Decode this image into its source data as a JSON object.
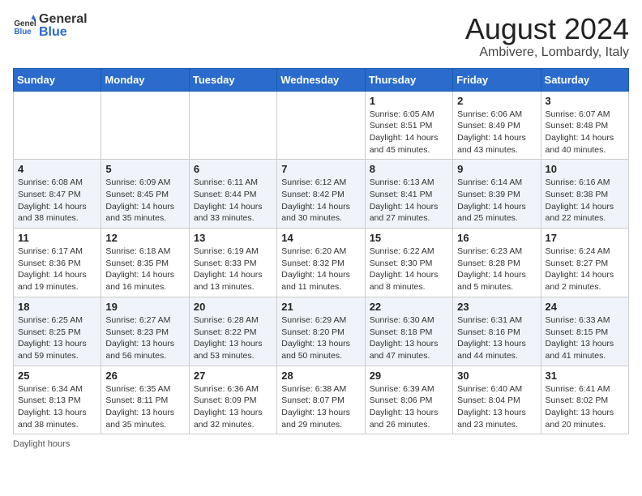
{
  "header": {
    "logo_general": "General",
    "logo_blue": "Blue",
    "main_title": "August 2024",
    "subtitle": "Ambivere, Lombardy, Italy"
  },
  "calendar": {
    "weekdays": [
      "Sunday",
      "Monday",
      "Tuesday",
      "Wednesday",
      "Thursday",
      "Friday",
      "Saturday"
    ],
    "weeks": [
      [
        {
          "day": "",
          "info": ""
        },
        {
          "day": "",
          "info": ""
        },
        {
          "day": "",
          "info": ""
        },
        {
          "day": "",
          "info": ""
        },
        {
          "day": "1",
          "info": "Sunrise: 6:05 AM\nSunset: 8:51 PM\nDaylight: 14 hours and 45 minutes."
        },
        {
          "day": "2",
          "info": "Sunrise: 6:06 AM\nSunset: 8:49 PM\nDaylight: 14 hours and 43 minutes."
        },
        {
          "day": "3",
          "info": "Sunrise: 6:07 AM\nSunset: 8:48 PM\nDaylight: 14 hours and 40 minutes."
        }
      ],
      [
        {
          "day": "4",
          "info": "Sunrise: 6:08 AM\nSunset: 8:47 PM\nDaylight: 14 hours and 38 minutes."
        },
        {
          "day": "5",
          "info": "Sunrise: 6:09 AM\nSunset: 8:45 PM\nDaylight: 14 hours and 35 minutes."
        },
        {
          "day": "6",
          "info": "Sunrise: 6:11 AM\nSunset: 8:44 PM\nDaylight: 14 hours and 33 minutes."
        },
        {
          "day": "7",
          "info": "Sunrise: 6:12 AM\nSunset: 8:42 PM\nDaylight: 14 hours and 30 minutes."
        },
        {
          "day": "8",
          "info": "Sunrise: 6:13 AM\nSunset: 8:41 PM\nDaylight: 14 hours and 27 minutes."
        },
        {
          "day": "9",
          "info": "Sunrise: 6:14 AM\nSunset: 8:39 PM\nDaylight: 14 hours and 25 minutes."
        },
        {
          "day": "10",
          "info": "Sunrise: 6:16 AM\nSunset: 8:38 PM\nDaylight: 14 hours and 22 minutes."
        }
      ],
      [
        {
          "day": "11",
          "info": "Sunrise: 6:17 AM\nSunset: 8:36 PM\nDaylight: 14 hours and 19 minutes."
        },
        {
          "day": "12",
          "info": "Sunrise: 6:18 AM\nSunset: 8:35 PM\nDaylight: 14 hours and 16 minutes."
        },
        {
          "day": "13",
          "info": "Sunrise: 6:19 AM\nSunset: 8:33 PM\nDaylight: 14 hours and 13 minutes."
        },
        {
          "day": "14",
          "info": "Sunrise: 6:20 AM\nSunset: 8:32 PM\nDaylight: 14 hours and 11 minutes."
        },
        {
          "day": "15",
          "info": "Sunrise: 6:22 AM\nSunset: 8:30 PM\nDaylight: 14 hours and 8 minutes."
        },
        {
          "day": "16",
          "info": "Sunrise: 6:23 AM\nSunset: 8:28 PM\nDaylight: 14 hours and 5 minutes."
        },
        {
          "day": "17",
          "info": "Sunrise: 6:24 AM\nSunset: 8:27 PM\nDaylight: 14 hours and 2 minutes."
        }
      ],
      [
        {
          "day": "18",
          "info": "Sunrise: 6:25 AM\nSunset: 8:25 PM\nDaylight: 13 hours and 59 minutes."
        },
        {
          "day": "19",
          "info": "Sunrise: 6:27 AM\nSunset: 8:23 PM\nDaylight: 13 hours and 56 minutes."
        },
        {
          "day": "20",
          "info": "Sunrise: 6:28 AM\nSunset: 8:22 PM\nDaylight: 13 hours and 53 minutes."
        },
        {
          "day": "21",
          "info": "Sunrise: 6:29 AM\nSunset: 8:20 PM\nDaylight: 13 hours and 50 minutes."
        },
        {
          "day": "22",
          "info": "Sunrise: 6:30 AM\nSunset: 8:18 PM\nDaylight: 13 hours and 47 minutes."
        },
        {
          "day": "23",
          "info": "Sunrise: 6:31 AM\nSunset: 8:16 PM\nDaylight: 13 hours and 44 minutes."
        },
        {
          "day": "24",
          "info": "Sunrise: 6:33 AM\nSunset: 8:15 PM\nDaylight: 13 hours and 41 minutes."
        }
      ],
      [
        {
          "day": "25",
          "info": "Sunrise: 6:34 AM\nSunset: 8:13 PM\nDaylight: 13 hours and 38 minutes."
        },
        {
          "day": "26",
          "info": "Sunrise: 6:35 AM\nSunset: 8:11 PM\nDaylight: 13 hours and 35 minutes."
        },
        {
          "day": "27",
          "info": "Sunrise: 6:36 AM\nSunset: 8:09 PM\nDaylight: 13 hours and 32 minutes."
        },
        {
          "day": "28",
          "info": "Sunrise: 6:38 AM\nSunset: 8:07 PM\nDaylight: 13 hours and 29 minutes."
        },
        {
          "day": "29",
          "info": "Sunrise: 6:39 AM\nSunset: 8:06 PM\nDaylight: 13 hours and 26 minutes."
        },
        {
          "day": "30",
          "info": "Sunrise: 6:40 AM\nSunset: 8:04 PM\nDaylight: 13 hours and 23 minutes."
        },
        {
          "day": "31",
          "info": "Sunrise: 6:41 AM\nSunset: 8:02 PM\nDaylight: 13 hours and 20 minutes."
        }
      ]
    ]
  },
  "footer": {
    "note": "Daylight hours"
  }
}
